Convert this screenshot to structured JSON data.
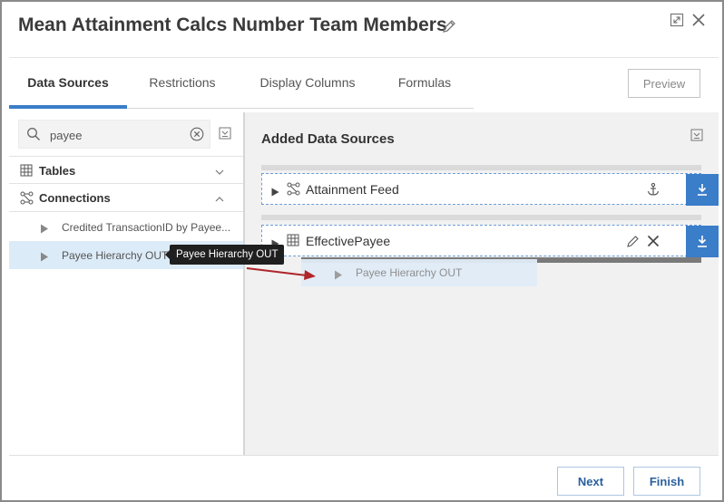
{
  "dialog": {
    "title": "Mean Attainment Calcs Number Team Members",
    "icons": [
      "pencil-icon",
      "expand-icon",
      "close-icon"
    ]
  },
  "tabs": [
    {
      "label": "Data Sources",
      "active": true
    },
    {
      "label": "Restrictions",
      "active": false
    },
    {
      "label": "Display Columns",
      "active": false
    },
    {
      "label": "Formulas",
      "active": false
    }
  ],
  "preview_label": "Preview",
  "left_panel": {
    "search": {
      "value": "payee",
      "placeholder": ""
    },
    "sections": [
      {
        "label": "Tables",
        "icon": "table-icon",
        "expanded": false
      },
      {
        "label": "Connections",
        "icon": "connection-icon",
        "expanded": true
      }
    ],
    "connections": [
      {
        "label": "Credited TransactionID by Payee...",
        "selected": false
      },
      {
        "label": "Payee Hierarchy OUT",
        "selected": true
      }
    ],
    "tooltip": "Payee Hierarchy OUT"
  },
  "right_panel": {
    "title": "Added Data Sources",
    "sources": [
      {
        "label": "Attainment Feed",
        "icon": "connection-icon",
        "actions": [
          "anchor-icon"
        ]
      },
      {
        "label": "EffectivePayee",
        "icon": "table-icon",
        "actions": [
          "pencil-icon",
          "close-icon"
        ]
      }
    ],
    "drag_ghost": "Payee Hierarchy OUT"
  },
  "footer": {
    "next_label": "Next",
    "finish_label": "Finish"
  },
  "colors": {
    "accent": "#3a7dc9",
    "selected_row": "#dcebf8",
    "drag_arrow": "#b0252a",
    "tooltip_bg": "#1f1f1f"
  }
}
